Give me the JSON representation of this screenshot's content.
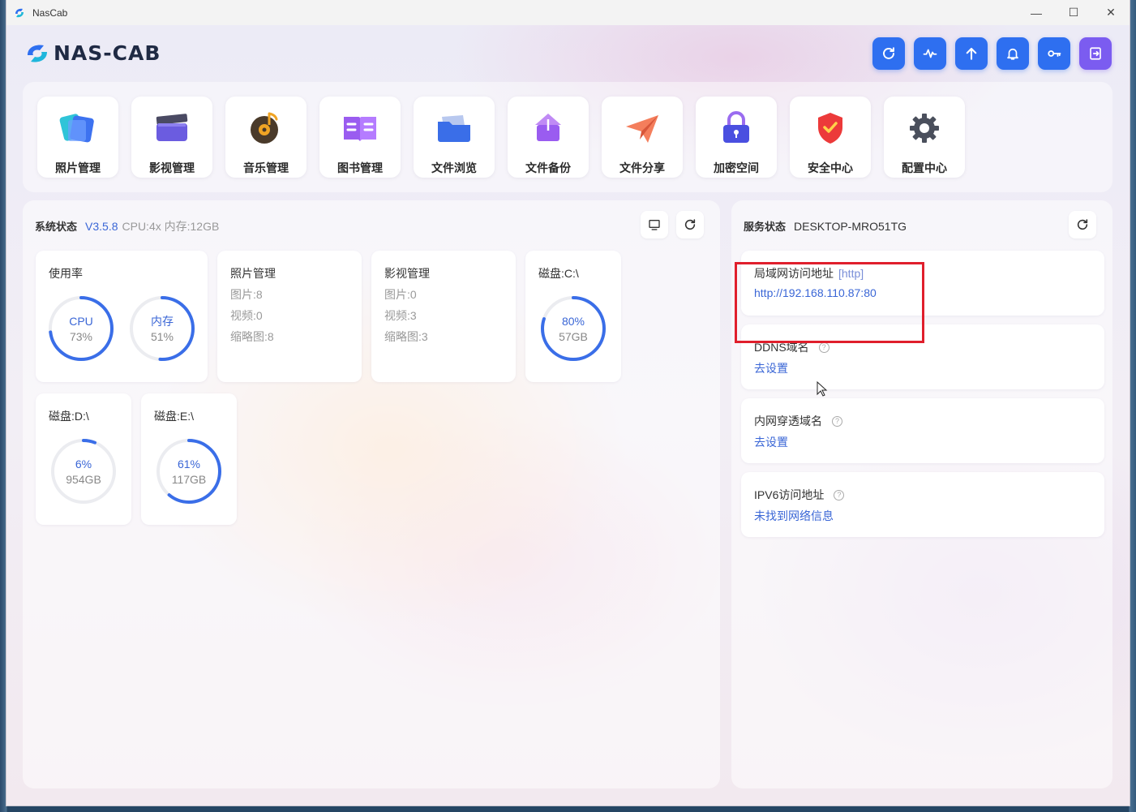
{
  "window": {
    "title": "NasCab",
    "minimize": "—",
    "maximize": "☐",
    "close": "✕"
  },
  "logo": {
    "text": "NAS-CAB"
  },
  "top_actions": [
    {
      "name": "refresh-icon"
    },
    {
      "name": "activity-icon"
    },
    {
      "name": "upload-icon"
    },
    {
      "name": "bell-icon"
    },
    {
      "name": "key-icon"
    },
    {
      "name": "logout-icon"
    }
  ],
  "apps": [
    {
      "label": "照片管理",
      "icon": "photos-icon"
    },
    {
      "label": "影视管理",
      "icon": "video-icon"
    },
    {
      "label": "音乐管理",
      "icon": "music-icon"
    },
    {
      "label": "图书管理",
      "icon": "book-icon"
    },
    {
      "label": "文件浏览",
      "icon": "folder-icon"
    },
    {
      "label": "文件备份",
      "icon": "backup-icon"
    },
    {
      "label": "文件分享",
      "icon": "share-icon"
    },
    {
      "label": "加密空间",
      "icon": "lock-icon"
    },
    {
      "label": "安全中心",
      "icon": "shield-icon"
    },
    {
      "label": "配置中心",
      "icon": "gear-icon"
    }
  ],
  "system": {
    "title": "系统状态",
    "version": "V3.5.8",
    "meta": "CPU:4x 内存:12GB",
    "usage": {
      "title": "使用率",
      "cpu": {
        "label": "CPU",
        "value": "73%",
        "pct": 73
      },
      "mem": {
        "label": "内存",
        "value": "51%",
        "pct": 51
      }
    },
    "photos": {
      "title": "照片管理",
      "lines": [
        "图片:8",
        "视频:0",
        "缩略图:8"
      ]
    },
    "videos": {
      "title": "影视管理",
      "lines": [
        "图片:0",
        "视频:3",
        "缩略图:3"
      ]
    },
    "disks": [
      {
        "title": "磁盘:C:\\",
        "value": "80%",
        "size": "57GB",
        "pct": 80
      },
      {
        "title": "磁盘:D:\\",
        "value": "6%",
        "size": "954GB",
        "pct": 6
      },
      {
        "title": "磁盘:E:\\",
        "value": "61%",
        "size": "117GB",
        "pct": 61
      }
    ]
  },
  "service": {
    "title": "服务状态",
    "host": "DESKTOP-MRO51TG",
    "lan": {
      "title": "局域网访问地址",
      "tag": "[http]",
      "link": "http://192.168.110.87:80"
    },
    "ddns": {
      "title": "DDNS域名",
      "help": "?",
      "link": "去设置"
    },
    "tunnel": {
      "title": "内网穿透域名",
      "help": "?",
      "link": "去设置"
    },
    "ipv6": {
      "title": "IPV6访问地址",
      "help": "?",
      "link": "未找到网络信息"
    }
  },
  "colors": {
    "accent": "#2e6ff0",
    "ring": "#3a6ee8",
    "track": "#ebecf0",
    "highlight": "#e01f2c"
  }
}
